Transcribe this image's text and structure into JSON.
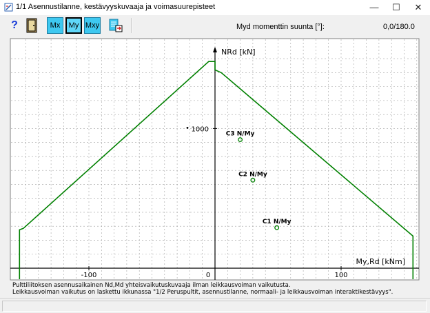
{
  "window": {
    "title": "1/1  Asennustilanne, kestävyyskuvaaja ja voimasuurepisteet",
    "minimize_glyph": "—",
    "maximize_glyph": "☐",
    "close_glyph": "✕"
  },
  "toolbar": {
    "help_label": "?",
    "door_icon": "door-icon",
    "mx_label": "Mx",
    "my_label": "My",
    "mxy_label": "Mxy",
    "export_icon": "document-export-icon",
    "direction_label": "Myd momenttin suunta [°]:",
    "direction_value": "0,0/180.0"
  },
  "chart_data": {
    "type": "line",
    "title": "",
    "xlabel": "My,Rd [kNm]",
    "ylabel": "NRd [kN]",
    "xlim": [
      -155,
      165
    ],
    "ylim": [
      -130,
      1550
    ],
    "x_ticks": [
      -100,
      0,
      100
    ],
    "x_tick_labels": [
      "-100",
      "0",
      "100"
    ],
    "y_ticks": [
      1000
    ],
    "y_tick_labels": [
      "1000"
    ],
    "grid": true,
    "colors": {
      "curve": "#008000",
      "points": "#008000",
      "grid": "#a0a0a0",
      "background": "#ffffff"
    },
    "series": [
      {
        "name": "",
        "points": [
          [
            -155,
            -130
          ],
          [
            -155,
            275
          ],
          [
            -152,
            285
          ],
          [
            -5,
            1480
          ],
          [
            0,
            1480
          ],
          [
            0,
            1420
          ],
          [
            5,
            1400
          ],
          [
            157,
            230
          ],
          [
            157,
            -130
          ]
        ]
      }
    ],
    "points": [
      {
        "label": "C3 N/My",
        "x": 20,
        "y": 920
      },
      {
        "label": "C2 N/My",
        "x": 30,
        "y": 630
      },
      {
        "label": "C1 N/My",
        "x": 49,
        "y": 290
      }
    ],
    "annotations": [
      "Pulttiliitoksen asennusaikainen Nd,Md yhteisvaikutuskuvaaja ilman leikkausvoiman vaikutusta.",
      "Leikkausvoiman vaikutus on laskettu ikkunassa \"1/2 Peruspultit, asennustilanne, normaali- ja leikkausvoiman  interaktikestävyys\"."
    ]
  }
}
